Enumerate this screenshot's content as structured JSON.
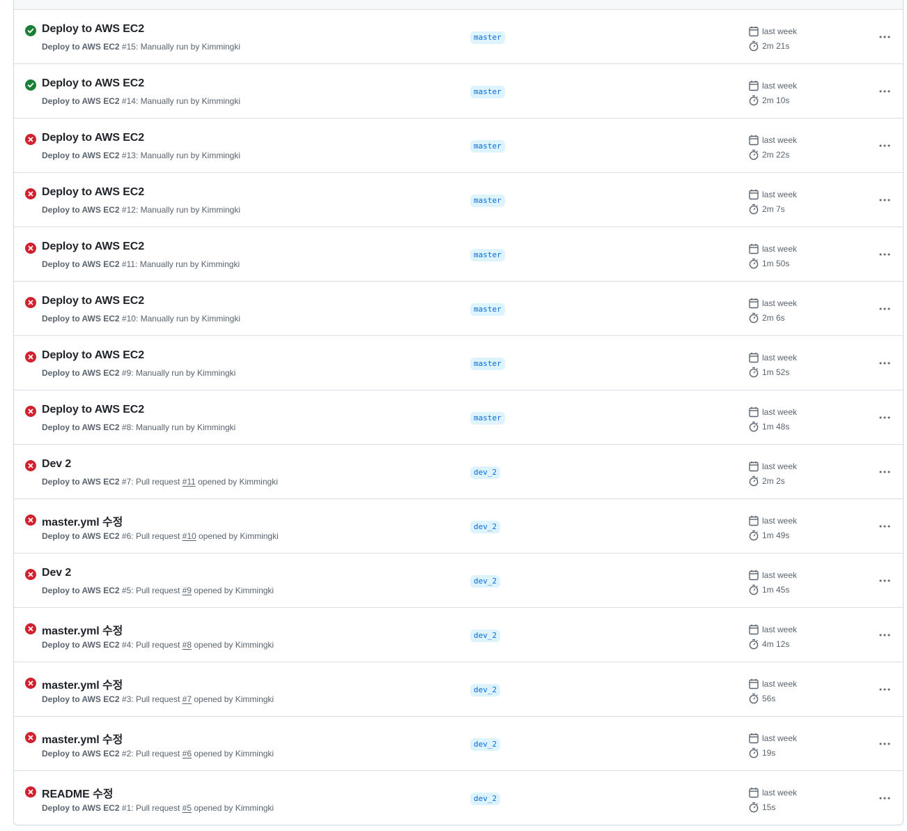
{
  "colors": {
    "success": "#1a7f37",
    "failure": "#cf222e",
    "branch_bg": "#ddf4ff",
    "branch_fg": "#0969da",
    "muted": "#59636e"
  },
  "icons": {
    "success": "check-circle-fill",
    "failure": "x-circle-fill",
    "calendar": "calendar-icon",
    "stopwatch": "stopwatch-icon",
    "more": "kebab-horizontal-icon"
  },
  "runs": [
    {
      "status": "success",
      "title": "Deploy to AWS EC2",
      "workflow": "Deploy to AWS EC2",
      "run_no": "#15",
      "trigger_pre": ": Manually run by Kimmingki",
      "pr": "",
      "trigger_post": "",
      "branch": "master",
      "date": "last week",
      "duration": "2m 21s"
    },
    {
      "status": "success",
      "title": "Deploy to AWS EC2",
      "workflow": "Deploy to AWS EC2",
      "run_no": "#14",
      "trigger_pre": ": Manually run by Kimmingki",
      "pr": "",
      "trigger_post": "",
      "branch": "master",
      "date": "last week",
      "duration": "2m 10s"
    },
    {
      "status": "failure",
      "title": "Deploy to AWS EC2",
      "workflow": "Deploy to AWS EC2",
      "run_no": "#13",
      "trigger_pre": ": Manually run by Kimmingki",
      "pr": "",
      "trigger_post": "",
      "branch": "master",
      "date": "last week",
      "duration": "2m 22s"
    },
    {
      "status": "failure",
      "title": "Deploy to AWS EC2",
      "workflow": "Deploy to AWS EC2",
      "run_no": "#12",
      "trigger_pre": ": Manually run by Kimmingki",
      "pr": "",
      "trigger_post": "",
      "branch": "master",
      "date": "last week",
      "duration": "2m 7s"
    },
    {
      "status": "failure",
      "title": "Deploy to AWS EC2",
      "workflow": "Deploy to AWS EC2",
      "run_no": "#11",
      "trigger_pre": ": Manually run by Kimmingki",
      "pr": "",
      "trigger_post": "",
      "branch": "master",
      "date": "last week",
      "duration": "1m 50s"
    },
    {
      "status": "failure",
      "title": "Deploy to AWS EC2",
      "workflow": "Deploy to AWS EC2",
      "run_no": "#10",
      "trigger_pre": ": Manually run by Kimmingki",
      "pr": "",
      "trigger_post": "",
      "branch": "master",
      "date": "last week",
      "duration": "2m 6s"
    },
    {
      "status": "failure",
      "title": "Deploy to AWS EC2",
      "workflow": "Deploy to AWS EC2",
      "run_no": "#9",
      "trigger_pre": ": Manually run by Kimmingki",
      "pr": "",
      "trigger_post": "",
      "branch": "master",
      "date": "last week",
      "duration": "1m 52s"
    },
    {
      "status": "failure",
      "title": "Deploy to AWS EC2",
      "workflow": "Deploy to AWS EC2",
      "run_no": "#8",
      "trigger_pre": ": Manually run by Kimmingki",
      "pr": "",
      "trigger_post": "",
      "branch": "master",
      "date": "last week",
      "duration": "1m 48s"
    },
    {
      "status": "failure",
      "title": "Dev 2",
      "workflow": "Deploy to AWS EC2",
      "run_no": "#7",
      "trigger_pre": ": Pull request ",
      "pr": "#11",
      "trigger_post": " opened by Kimmingki",
      "branch": "dev_2",
      "date": "last week",
      "duration": "2m 2s"
    },
    {
      "status": "failure",
      "title": "master.yml 수정",
      "workflow": "Deploy to AWS EC2",
      "run_no": "#6",
      "trigger_pre": ": Pull request ",
      "pr": "#10",
      "trigger_post": " opened by Kimmingki",
      "branch": "dev_2",
      "date": "last week",
      "duration": "1m 49s"
    },
    {
      "status": "failure",
      "title": "Dev 2",
      "workflow": "Deploy to AWS EC2",
      "run_no": "#5",
      "trigger_pre": ": Pull request ",
      "pr": "#9",
      "trigger_post": " opened by Kimmingki",
      "branch": "dev_2",
      "date": "last week",
      "duration": "1m 45s"
    },
    {
      "status": "failure",
      "title": "master.yml 수정",
      "workflow": "Deploy to AWS EC2",
      "run_no": "#4",
      "trigger_pre": ": Pull request ",
      "pr": "#8",
      "trigger_post": " opened by Kimmingki",
      "branch": "dev_2",
      "date": "last week",
      "duration": "4m 12s"
    },
    {
      "status": "failure",
      "title": "master.yml 수정",
      "workflow": "Deploy to AWS EC2",
      "run_no": "#3",
      "trigger_pre": ": Pull request ",
      "pr": "#7",
      "trigger_post": " opened by Kimmingki",
      "branch": "dev_2",
      "date": "last week",
      "duration": "56s"
    },
    {
      "status": "failure",
      "title": "master.yml 수정",
      "workflow": "Deploy to AWS EC2",
      "run_no": "#2",
      "trigger_pre": ": Pull request ",
      "pr": "#6",
      "trigger_post": " opened by Kimmingki",
      "branch": "dev_2",
      "date": "last week",
      "duration": "19s"
    },
    {
      "status": "failure",
      "title": "README 수정",
      "workflow": "Deploy to AWS EC2",
      "run_no": "#1",
      "trigger_pre": ": Pull request ",
      "pr": "#5",
      "trigger_post": " opened by Kimmingki",
      "branch": "dev_2",
      "date": "last week",
      "duration": "15s"
    }
  ]
}
